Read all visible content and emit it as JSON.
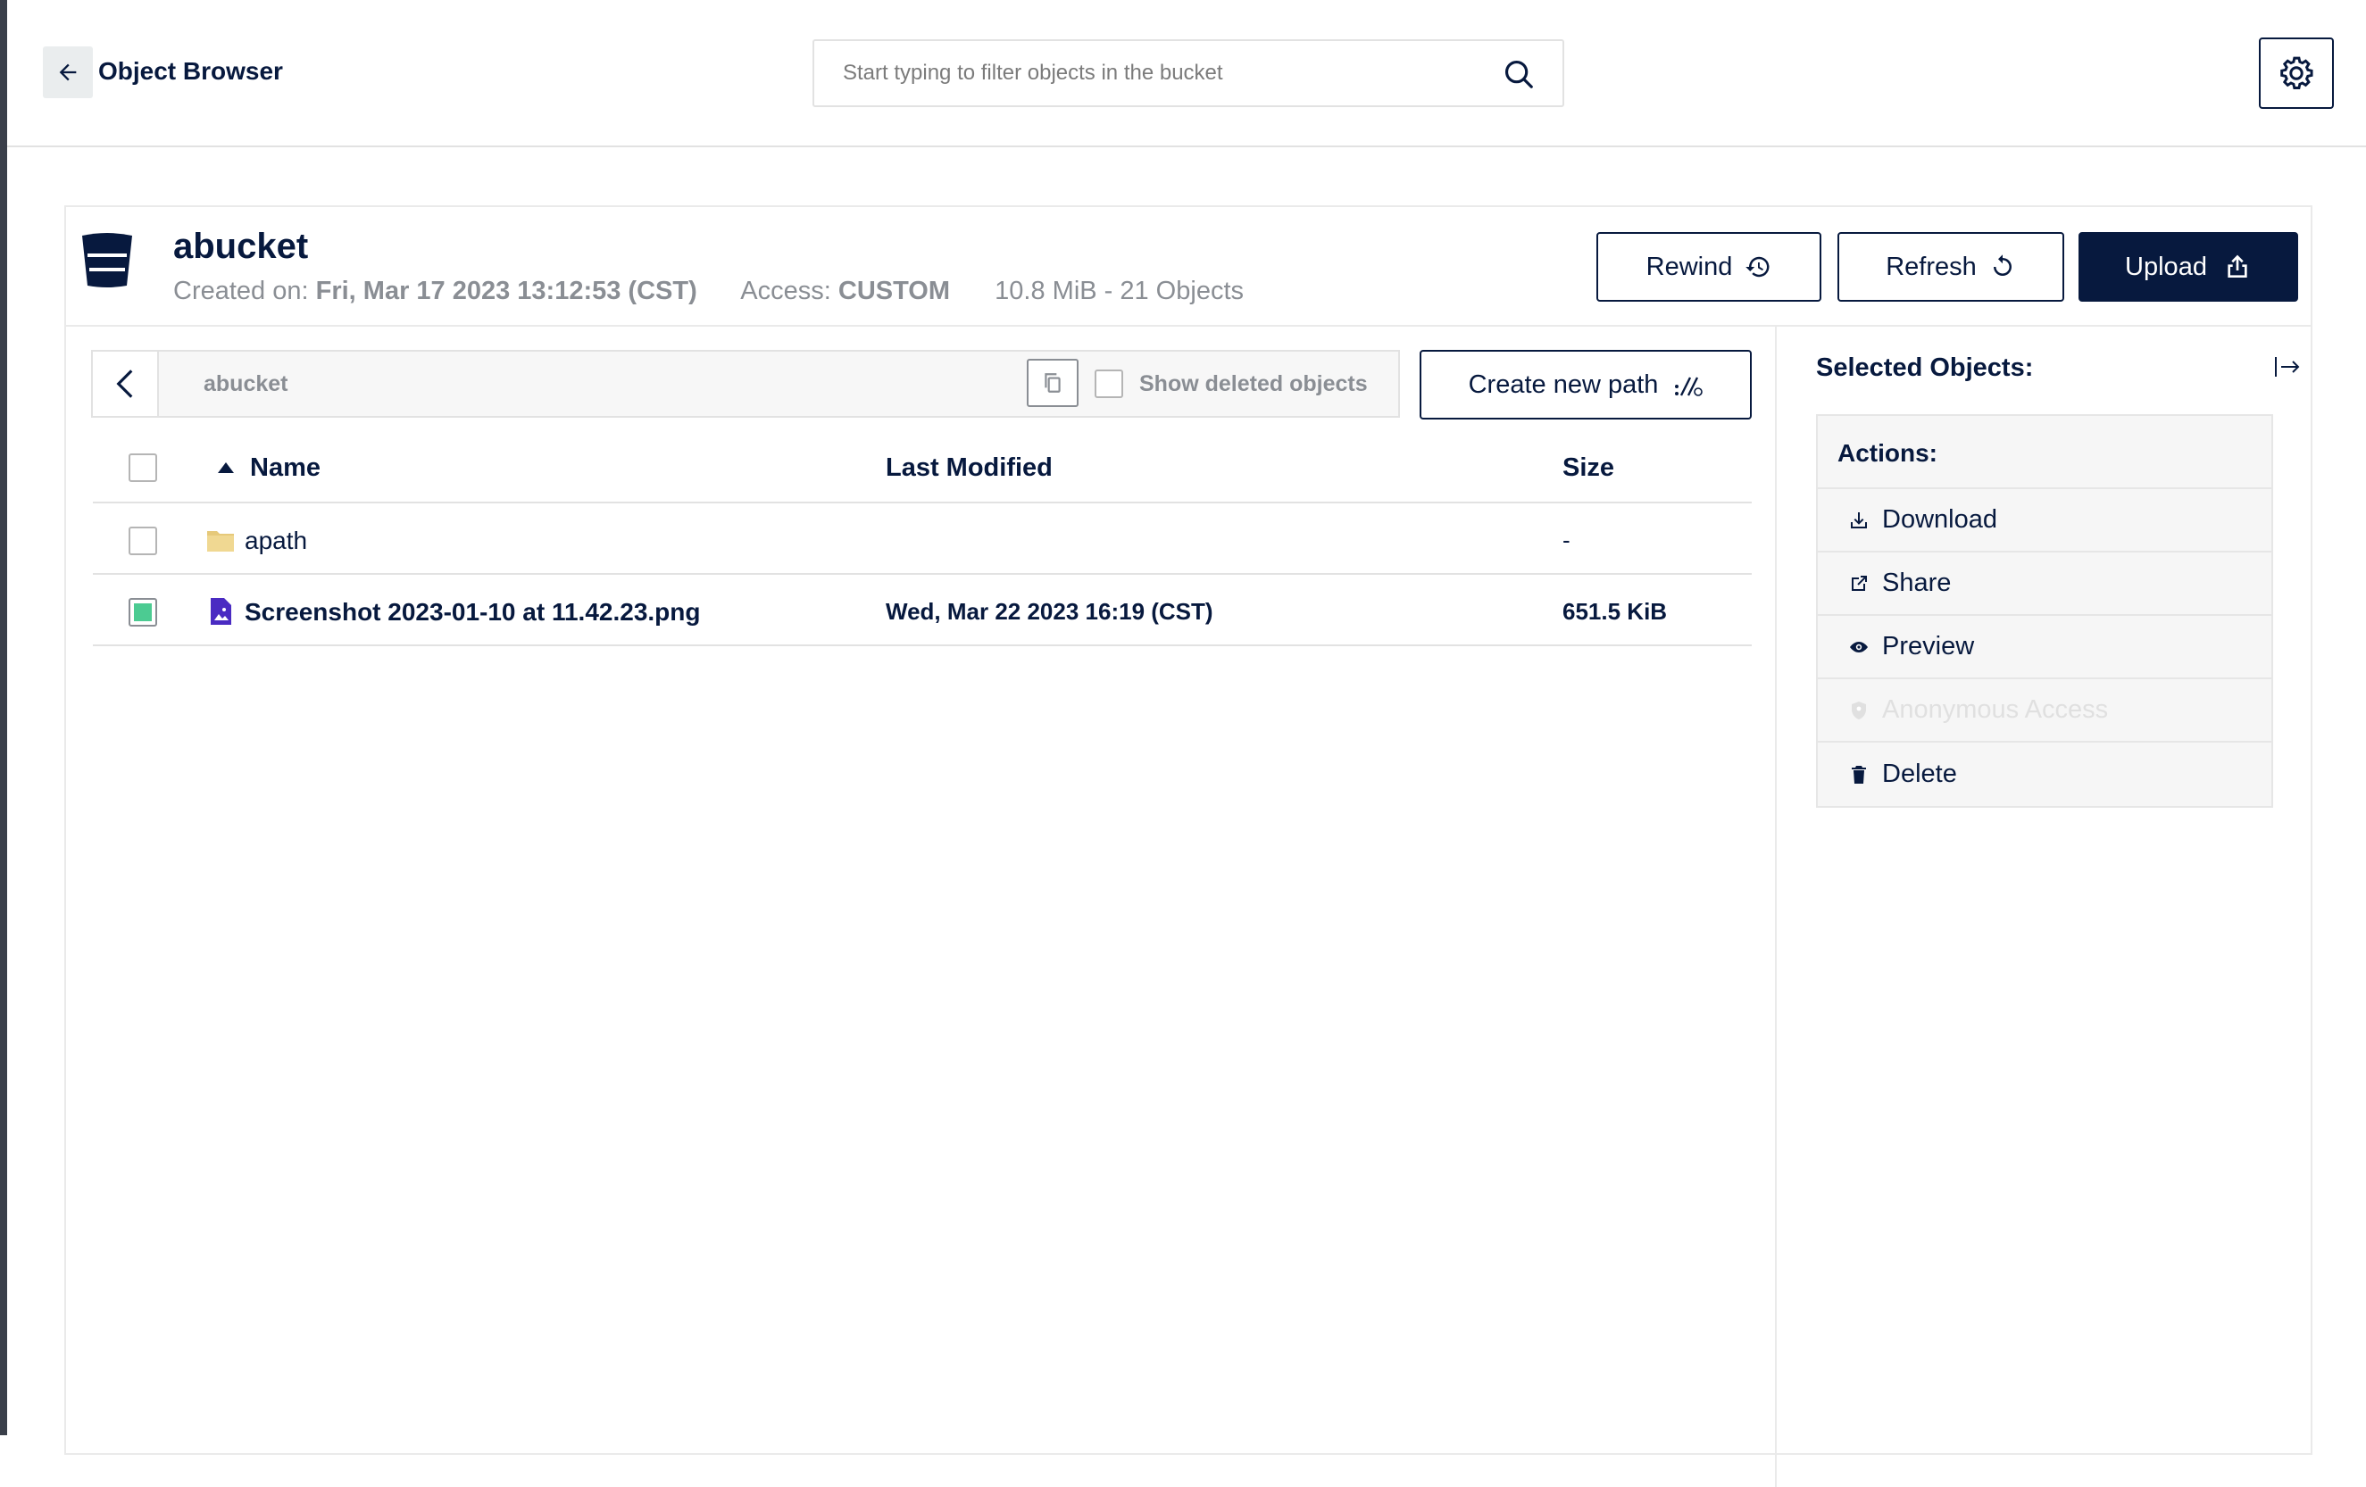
{
  "header": {
    "title": "Object Browser",
    "search_placeholder": "Start typing to filter objects in the bucket"
  },
  "bucket": {
    "name": "abucket",
    "created_label": "Created on:",
    "created_value": "Fri, Mar 17 2023 13:12:53 (CST)",
    "access_label": "Access:",
    "access_value": "CUSTOM",
    "usage": "10.8 MiB - 21 Objects"
  },
  "buttons": {
    "rewind": "Rewind",
    "refresh": "Refresh",
    "upload": "Upload",
    "create_path": "Create new path"
  },
  "pathbar": {
    "crumb": "abucket",
    "show_deleted": "Show deleted objects"
  },
  "table": {
    "columns": {
      "name": "Name",
      "modified": "Last Modified",
      "size": "Size"
    },
    "rows": [
      {
        "type": "folder",
        "name": "apath",
        "modified": "",
        "size": "-",
        "selected": false
      },
      {
        "type": "image",
        "name": "Screenshot 2023-01-10 at 11.42.23.png",
        "modified": "Wed, Mar 22 2023 16:19 (CST)",
        "size": "651.5 KiB",
        "selected": true
      }
    ]
  },
  "side": {
    "title": "Selected Objects:",
    "actions_title": "Actions:",
    "actions": [
      {
        "label": "Download",
        "icon": "download-icon",
        "disabled": false
      },
      {
        "label": "Share",
        "icon": "share-icon",
        "disabled": false
      },
      {
        "label": "Preview",
        "icon": "eye-icon",
        "disabled": false
      },
      {
        "label": "Anonymous Access",
        "icon": "shield-icon",
        "disabled": true
      },
      {
        "label": "Delete",
        "icon": "trash-icon",
        "disabled": false
      }
    ]
  },
  "colors": {
    "primary": "#07193e",
    "muted": "#8a8e94",
    "selected_check": "#4ccb92",
    "folder": "#e6c97a",
    "file_icon": "#4a2bc2"
  }
}
